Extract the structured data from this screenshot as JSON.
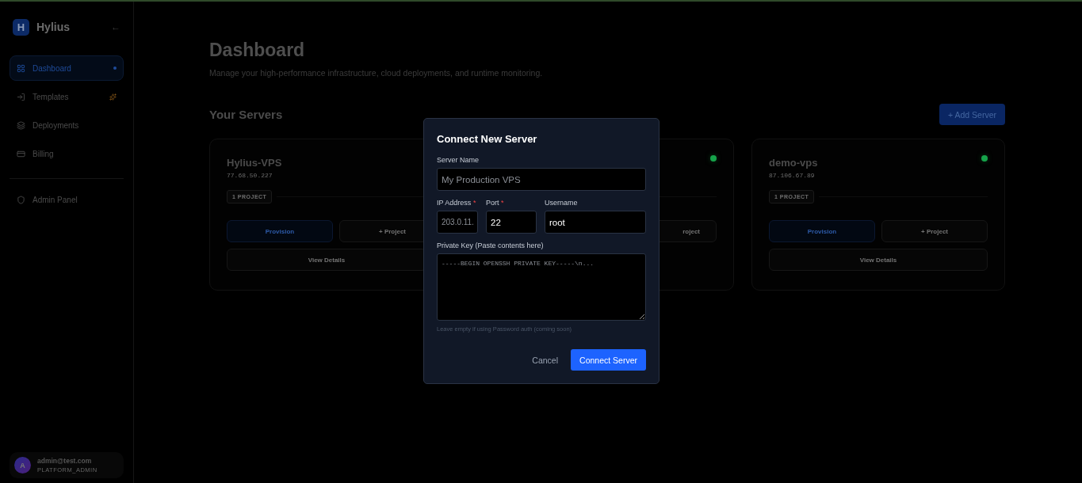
{
  "sidebar": {
    "brand": {
      "letter": "H",
      "name": "Hylius"
    },
    "collapse": "←",
    "items": [
      {
        "label": "Dashboard",
        "selected": true
      },
      {
        "label": "Templates",
        "selected": false
      },
      {
        "label": "Deployments",
        "selected": false
      },
      {
        "label": "Billing",
        "selected": false
      }
    ],
    "admin_items": [
      {
        "label": "Admin Panel",
        "selected": false
      }
    ],
    "user": {
      "initial": "A",
      "email": "admin@test.com",
      "role": "PLATFORM_ADMIN"
    }
  },
  "page": {
    "title": "Dashboard",
    "subtitle": "Manage your high-performance infrastructure, cloud deployments, and runtime monitoring.",
    "section_title": "Your Servers",
    "add_button": "+ Add Server"
  },
  "servers": [
    {
      "name": "Hylius-VPS",
      "ip": "77.68.50.227",
      "projects": "1 PROJECT",
      "provision": "Provision",
      "project_button": "+ Project",
      "details": "View Details"
    },
    {
      "project_button": "roject"
    },
    {
      "name": "demo-vps",
      "ip": "87.106.67.89",
      "projects": "1 PROJECT",
      "provision": "Provision",
      "project_button": "+ Project",
      "details": "View Details"
    }
  ],
  "dialog": {
    "title": "Connect New Server",
    "fields": [
      {
        "label": "Server Name",
        "placeholder": "My Production VPS",
        "kind": "text"
      },
      {
        "label": "IP Address",
        "required_mark": "*",
        "placeholder": "203.0.11.",
        "kind": "text"
      },
      {
        "label": "Port",
        "required_mark": "*",
        "value": "22",
        "kind": "text"
      },
      {
        "label": "Username",
        "value": "root",
        "kind": "text"
      },
      {
        "label": "Private Key (Paste contents here)",
        "placeholder": "-----BEGIN OPENSSH PRIVATE KEY-----\\n...",
        "kind": "textarea"
      }
    ],
    "hint": "Leave empty if using Password auth (coming soon)",
    "cancel": "Cancel",
    "submit": "Connect Server"
  }
}
